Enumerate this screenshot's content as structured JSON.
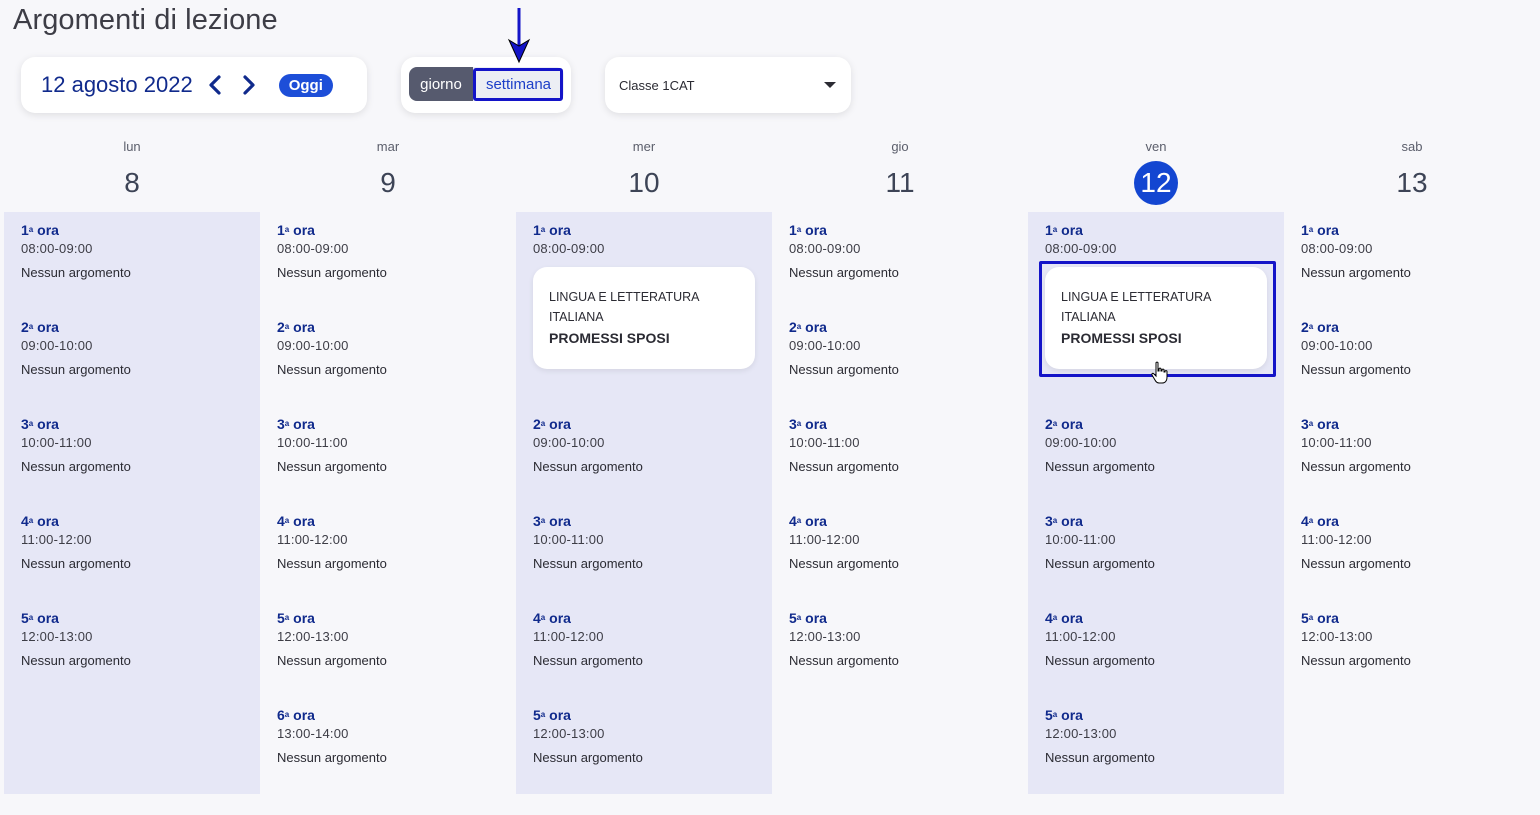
{
  "page": {
    "title": "Argomenti di lezione"
  },
  "date_nav": {
    "date_label": "12 agosto 2022",
    "prev_icon": "chevron-left-icon",
    "next_icon": "chevron-right-icon",
    "today_label": "Oggi"
  },
  "view_toggle": {
    "day_label": "giorno",
    "week_label": "settimana",
    "selected": "settimana"
  },
  "class_select": {
    "value": "Classe 1CAT",
    "icon": "caret-down-icon"
  },
  "colors": {
    "accent": "#1346d1",
    "navy": "#102a8c",
    "shaded_col": "#e6e7f6",
    "highlight": "#1414c8"
  },
  "no_topic": "Nessun argomento",
  "days": [
    {
      "name": "lun",
      "number": "8",
      "today": false,
      "shaded": true,
      "slots": [
        {
          "ord": "1",
          "sup": "a",
          "label": "ora",
          "time": "08:00-09:00",
          "note": "Nessun argomento"
        },
        {
          "ord": "2",
          "sup": "a",
          "label": "ora",
          "time": "09:00-10:00",
          "note": "Nessun argomento"
        },
        {
          "ord": "3",
          "sup": "a",
          "label": "ora",
          "time": "10:00-11:00",
          "note": "Nessun argomento"
        },
        {
          "ord": "4",
          "sup": "a",
          "label": "ora",
          "time": "11:00-12:00",
          "note": "Nessun argomento"
        },
        {
          "ord": "5",
          "sup": "a",
          "label": "ora",
          "time": "12:00-13:00",
          "note": "Nessun argomento"
        }
      ]
    },
    {
      "name": "mar",
      "number": "9",
      "today": false,
      "shaded": false,
      "slots": [
        {
          "ord": "1",
          "sup": "a",
          "label": "ora",
          "time": "08:00-09:00",
          "note": "Nessun argomento"
        },
        {
          "ord": "2",
          "sup": "a",
          "label": "ora",
          "time": "09:00-10:00",
          "note": "Nessun argomento"
        },
        {
          "ord": "3",
          "sup": "a",
          "label": "ora",
          "time": "10:00-11:00",
          "note": "Nessun argomento"
        },
        {
          "ord": "4",
          "sup": "a",
          "label": "ora",
          "time": "11:00-12:00",
          "note": "Nessun argomento"
        },
        {
          "ord": "5",
          "sup": "a",
          "label": "ora",
          "time": "12:00-13:00",
          "note": "Nessun argomento"
        },
        {
          "ord": "6",
          "sup": "a",
          "label": "ora",
          "time": "13:00-14:00",
          "note": "Nessun argomento"
        }
      ]
    },
    {
      "name": "mer",
      "number": "10",
      "today": false,
      "shaded": true,
      "slots": [
        {
          "ord": "1",
          "sup": "a",
          "label": "ora",
          "time": "08:00-09:00",
          "lesson": {
            "subject": "LINGUA E LETTERATURA ITALIANA",
            "topic": "PROMESSI SPOSI"
          }
        },
        {
          "ord": "2",
          "sup": "a",
          "label": "ora",
          "time": "09:00-10:00",
          "note": "Nessun argomento"
        },
        {
          "ord": "3",
          "sup": "a",
          "label": "ora",
          "time": "10:00-11:00",
          "note": "Nessun argomento"
        },
        {
          "ord": "4",
          "sup": "a",
          "label": "ora",
          "time": "11:00-12:00",
          "note": "Nessun argomento"
        },
        {
          "ord": "5",
          "sup": "a",
          "label": "ora",
          "time": "12:00-13:00",
          "note": "Nessun argomento"
        }
      ]
    },
    {
      "name": "gio",
      "number": "11",
      "today": false,
      "shaded": false,
      "slots": [
        {
          "ord": "1",
          "sup": "a",
          "label": "ora",
          "time": "08:00-09:00",
          "note": "Nessun argomento"
        },
        {
          "ord": "2",
          "sup": "a",
          "label": "ora",
          "time": "09:00-10:00",
          "note": "Nessun argomento"
        },
        {
          "ord": "3",
          "sup": "a",
          "label": "ora",
          "time": "10:00-11:00",
          "note": "Nessun argomento"
        },
        {
          "ord": "4",
          "sup": "a",
          "label": "ora",
          "time": "11:00-12:00",
          "note": "Nessun argomento"
        },
        {
          "ord": "5",
          "sup": "a",
          "label": "ora",
          "time": "12:00-13:00",
          "note": "Nessun argomento"
        }
      ]
    },
    {
      "name": "ven",
      "number": "12",
      "today": true,
      "shaded": true,
      "slots": [
        {
          "ord": "1",
          "sup": "a",
          "label": "ora",
          "time": "08:00-09:00",
          "lesson": {
            "subject": "LINGUA E LETTERATURA ITALIANA",
            "topic": "PROMESSI SPOSI"
          }
        },
        {
          "ord": "2",
          "sup": "a",
          "label": "ora",
          "time": "09:00-10:00",
          "note": "Nessun argomento"
        },
        {
          "ord": "3",
          "sup": "a",
          "label": "ora",
          "time": "10:00-11:00",
          "note": "Nessun argomento"
        },
        {
          "ord": "4",
          "sup": "a",
          "label": "ora",
          "time": "11:00-12:00",
          "note": "Nessun argomento"
        },
        {
          "ord": "5",
          "sup": "a",
          "label": "ora",
          "time": "12:00-13:00",
          "note": "Nessun argomento"
        }
      ]
    },
    {
      "name": "sab",
      "number": "13",
      "today": false,
      "shaded": false,
      "slots": [
        {
          "ord": "1",
          "sup": "a",
          "label": "ora",
          "time": "08:00-09:00",
          "note": "Nessun argomento"
        },
        {
          "ord": "2",
          "sup": "a",
          "label": "ora",
          "time": "09:00-10:00",
          "note": "Nessun argomento"
        },
        {
          "ord": "3",
          "sup": "a",
          "label": "ora",
          "time": "10:00-11:00",
          "note": "Nessun argomento"
        },
        {
          "ord": "4",
          "sup": "a",
          "label": "ora",
          "time": "11:00-12:00",
          "note": "Nessun argomento"
        },
        {
          "ord": "5",
          "sup": "a",
          "label": "ora",
          "time": "12:00-13:00",
          "note": "Nessun argomento"
        }
      ]
    }
  ],
  "annotations": {
    "arrow_icon": "down-arrow-icon",
    "cursor_icon": "hand-pointer-icon"
  }
}
